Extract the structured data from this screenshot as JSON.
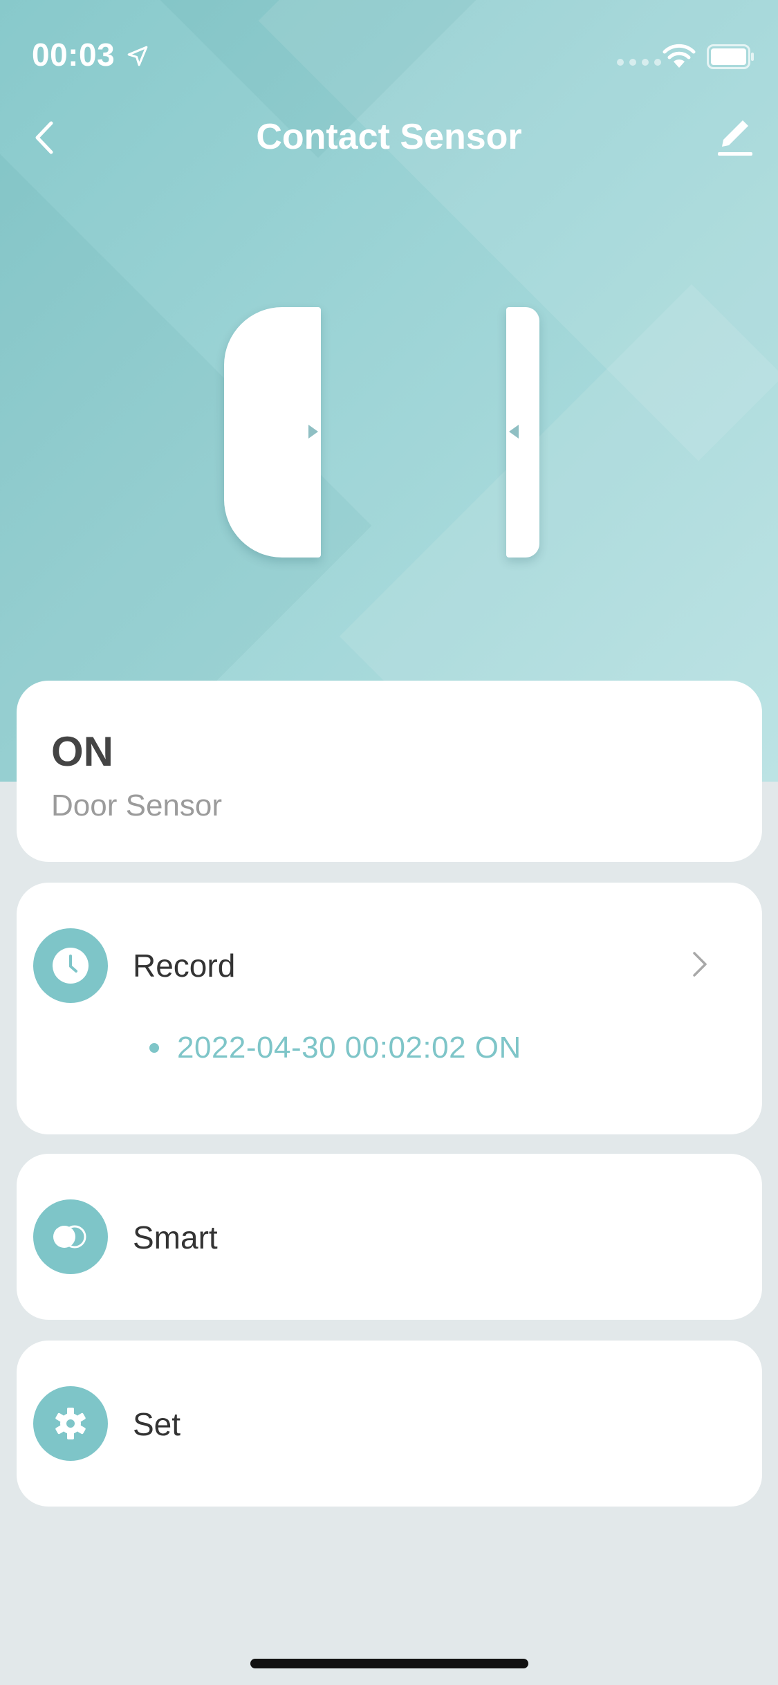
{
  "status_bar": {
    "time": "00:03",
    "icons": [
      "location-arrow-icon",
      "signal-icon",
      "wifi-icon",
      "battery-icon"
    ]
  },
  "nav": {
    "title": "Contact Sensor",
    "back_icon": "chevron-left-icon",
    "edit_icon": "pencil-icon"
  },
  "sensor": {
    "state": "ON",
    "name": "Door Sensor"
  },
  "record": {
    "label": "Record",
    "latest_entry": "2022-04-30 00:02:02 ON",
    "icon": "clock-icon"
  },
  "smart": {
    "label": "Smart",
    "icon": "toggle-circles-icon"
  },
  "set": {
    "label": "Set",
    "icon": "gear-icon"
  },
  "colors": {
    "accent": "#7ec5c8",
    "hero_gradient_start": "#88c9cb",
    "hero_gradient_end": "#b5e0e1",
    "background": "#e2e8ea",
    "card": "#ffffff"
  }
}
